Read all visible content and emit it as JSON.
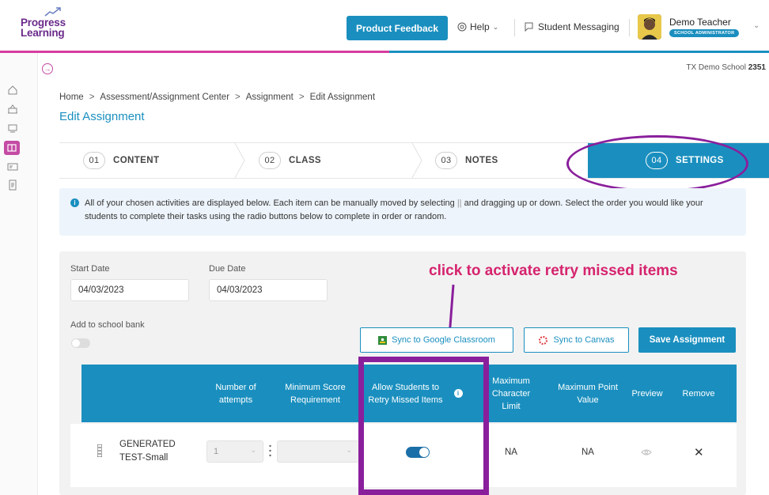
{
  "header": {
    "logo_line1": "Progress",
    "logo_line2": "Learning",
    "feedback_label": "Product Feedback",
    "help_label": "Help",
    "messaging_label": "Student Messaging",
    "user_name": "Demo Teacher",
    "user_role": "SCHOOL ADMINISTRATOR"
  },
  "school": {
    "name": "TX Demo School",
    "id": "2351"
  },
  "breadcrumb": [
    "Home",
    "Assessment/Assignment Center",
    "Assignment",
    "Edit Assignment"
  ],
  "page_title": "Edit Assignment",
  "steps": [
    {
      "num": "01",
      "label": "CONTENT"
    },
    {
      "num": "02",
      "label": "CLASS"
    },
    {
      "num": "03",
      "label": "NOTES"
    },
    {
      "num": "04",
      "label": "SETTINGS"
    }
  ],
  "info": {
    "text_before": "All of your chosen activities are displayed below. Each item can be manually moved by selecting",
    "handle_glyph": "||",
    "text_after": "and dragging up or down. Select the order you would like your students to complete their tasks using the radio buttons below to complete in order or random."
  },
  "form": {
    "start_label": "Start Date",
    "start_value": "04/03/2023",
    "due_label": "Due Date",
    "due_value": "04/03/2023",
    "bank_label": "Add to school bank",
    "bank_toggle": false
  },
  "annotation": "click to activate retry missed items",
  "buttons": {
    "google": "Sync to Google Classroom",
    "canvas": "Sync to Canvas",
    "save": "Save Assignment"
  },
  "table": {
    "columns": {
      "attempts": "Number of attempts",
      "min_score": "Minimum Score Requirement",
      "retry": "Allow Students to Retry Missed Items",
      "max_char": "Maximum Character Limit",
      "max_point": "Maximum Point Value",
      "preview": "Preview",
      "remove": "Remove"
    },
    "row": {
      "name_line1": "GENERATED",
      "name_line2": "TEST-Small",
      "attempts": "1",
      "retry_on": true,
      "max_char": "NA",
      "max_point": "NA",
      "remove_glyph": "✕"
    }
  },
  "colors": {
    "primary": "#1a8fbf",
    "brand_purple": "#6a2a8a",
    "accent_pink": "#d6246e",
    "highlight_purple": "#8a1f9c"
  }
}
